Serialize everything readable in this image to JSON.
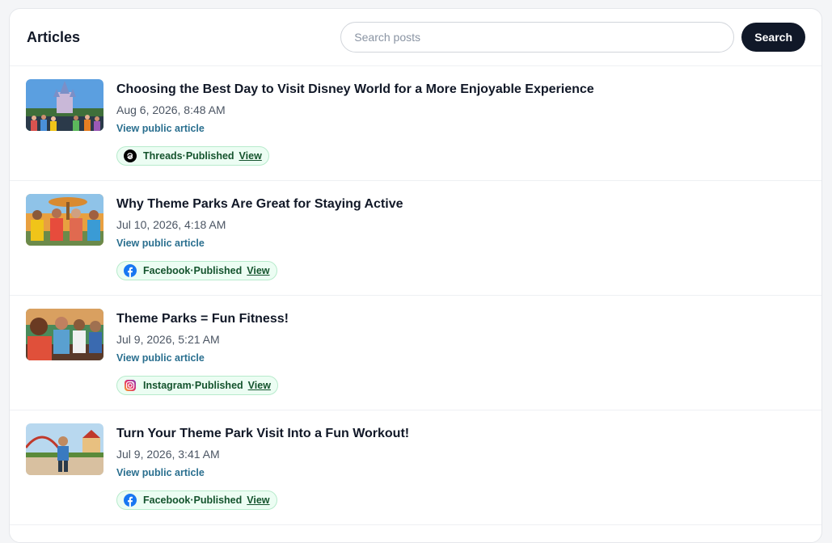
{
  "header": {
    "title": "Articles",
    "search_placeholder": "Search posts",
    "search_button": "Search"
  },
  "articles": [
    {
      "title": "Choosing the Best Day to Visit Disney World for a More Enjoyable Experience",
      "date": "Aug 6, 2026, 8:48 AM",
      "link": "View public article",
      "platform": "Threads",
      "status_sep": " · ",
      "status": "Published",
      "view": "View",
      "icon": "threads-icon"
    },
    {
      "title": "Why Theme Parks Are Great for Staying Active",
      "date": "Jul 10, 2026, 4:18 AM",
      "link": "View public article",
      "platform": "Facebook",
      "status_sep": " · ",
      "status": "Published",
      "view": "View",
      "icon": "facebook-icon"
    },
    {
      "title": "Theme Parks = Fun Fitness!",
      "date": "Jul 9, 2026, 5:21 AM",
      "link": "View public article",
      "platform": "Instagram",
      "status_sep": " · ",
      "status": "Published",
      "view": "View",
      "icon": "instagram-icon"
    },
    {
      "title": "Turn Your Theme Park Visit Into a Fun Workout!",
      "date": "Jul 9, 2026, 3:41 AM",
      "link": "View public article",
      "platform": "Facebook",
      "status_sep": " · ",
      "status": "Published",
      "view": "View",
      "icon": "facebook-icon"
    }
  ],
  "colors": {
    "accent_dark": "#101828",
    "link": "#2a6f8f",
    "badge_bg": "#ecfdf3",
    "badge_text": "#14532d",
    "facebook": "#1877f2"
  }
}
